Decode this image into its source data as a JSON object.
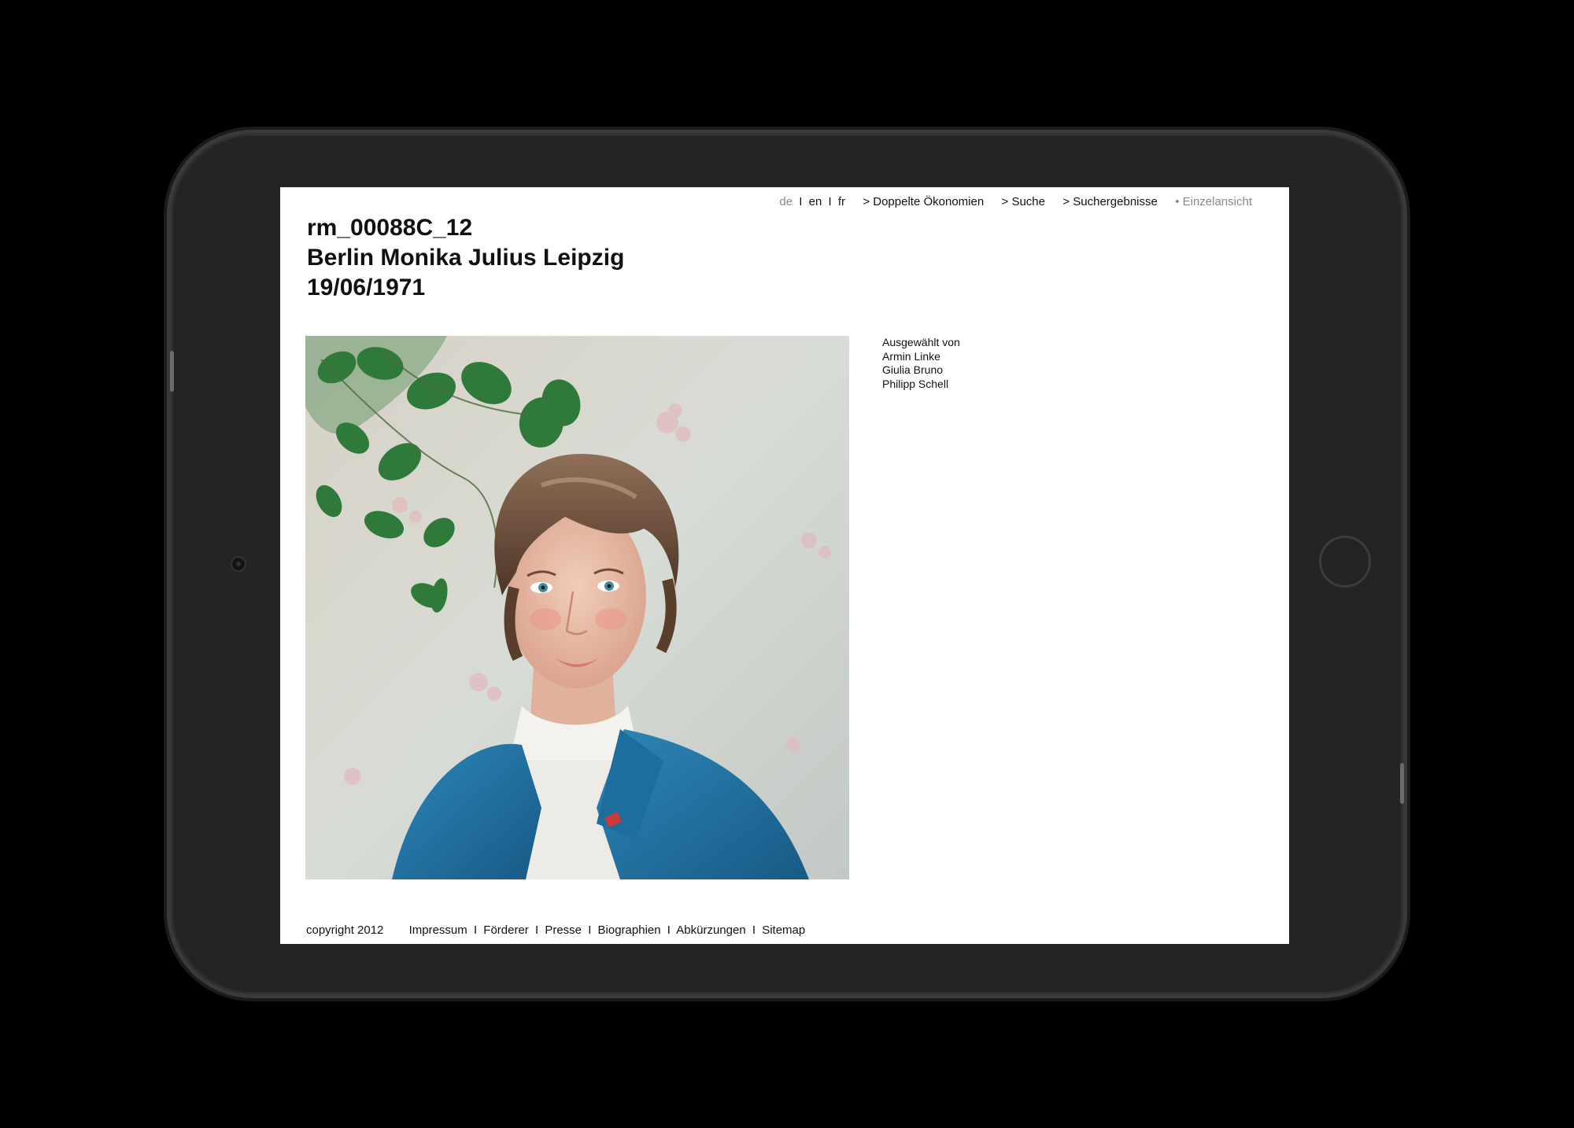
{
  "header": {
    "lang_current": "de",
    "lang_options": [
      "en",
      "fr"
    ],
    "breadcrumbs": [
      "> Doppelte Ökonomien",
      "> Suche",
      "> Suchergebnisse"
    ],
    "current_page": "• Einzelansicht"
  },
  "record": {
    "id": "rm_00088C_12",
    "caption": "Berlin Monika Julius Leipzig",
    "date": "19/06/1971"
  },
  "credits": {
    "label": "Ausgewählt von",
    "names": [
      "Armin Linke",
      "Giulia Bruno",
      "Philipp Schell"
    ]
  },
  "footer": {
    "copyright": "copyright 2012",
    "links": [
      "Impressum",
      "Förderer",
      "Presse",
      "Biographien",
      "Abkürzungen",
      "Sitemap"
    ]
  },
  "colors": {
    "device_frame": "#242424",
    "device_bezel": "#3a3a3a",
    "screen_bg": "#ffffff",
    "text": "#111111",
    "muted": "#888888",
    "jacket_blue": "#1f6f9f",
    "leaf_green": "#2f7a3a"
  }
}
